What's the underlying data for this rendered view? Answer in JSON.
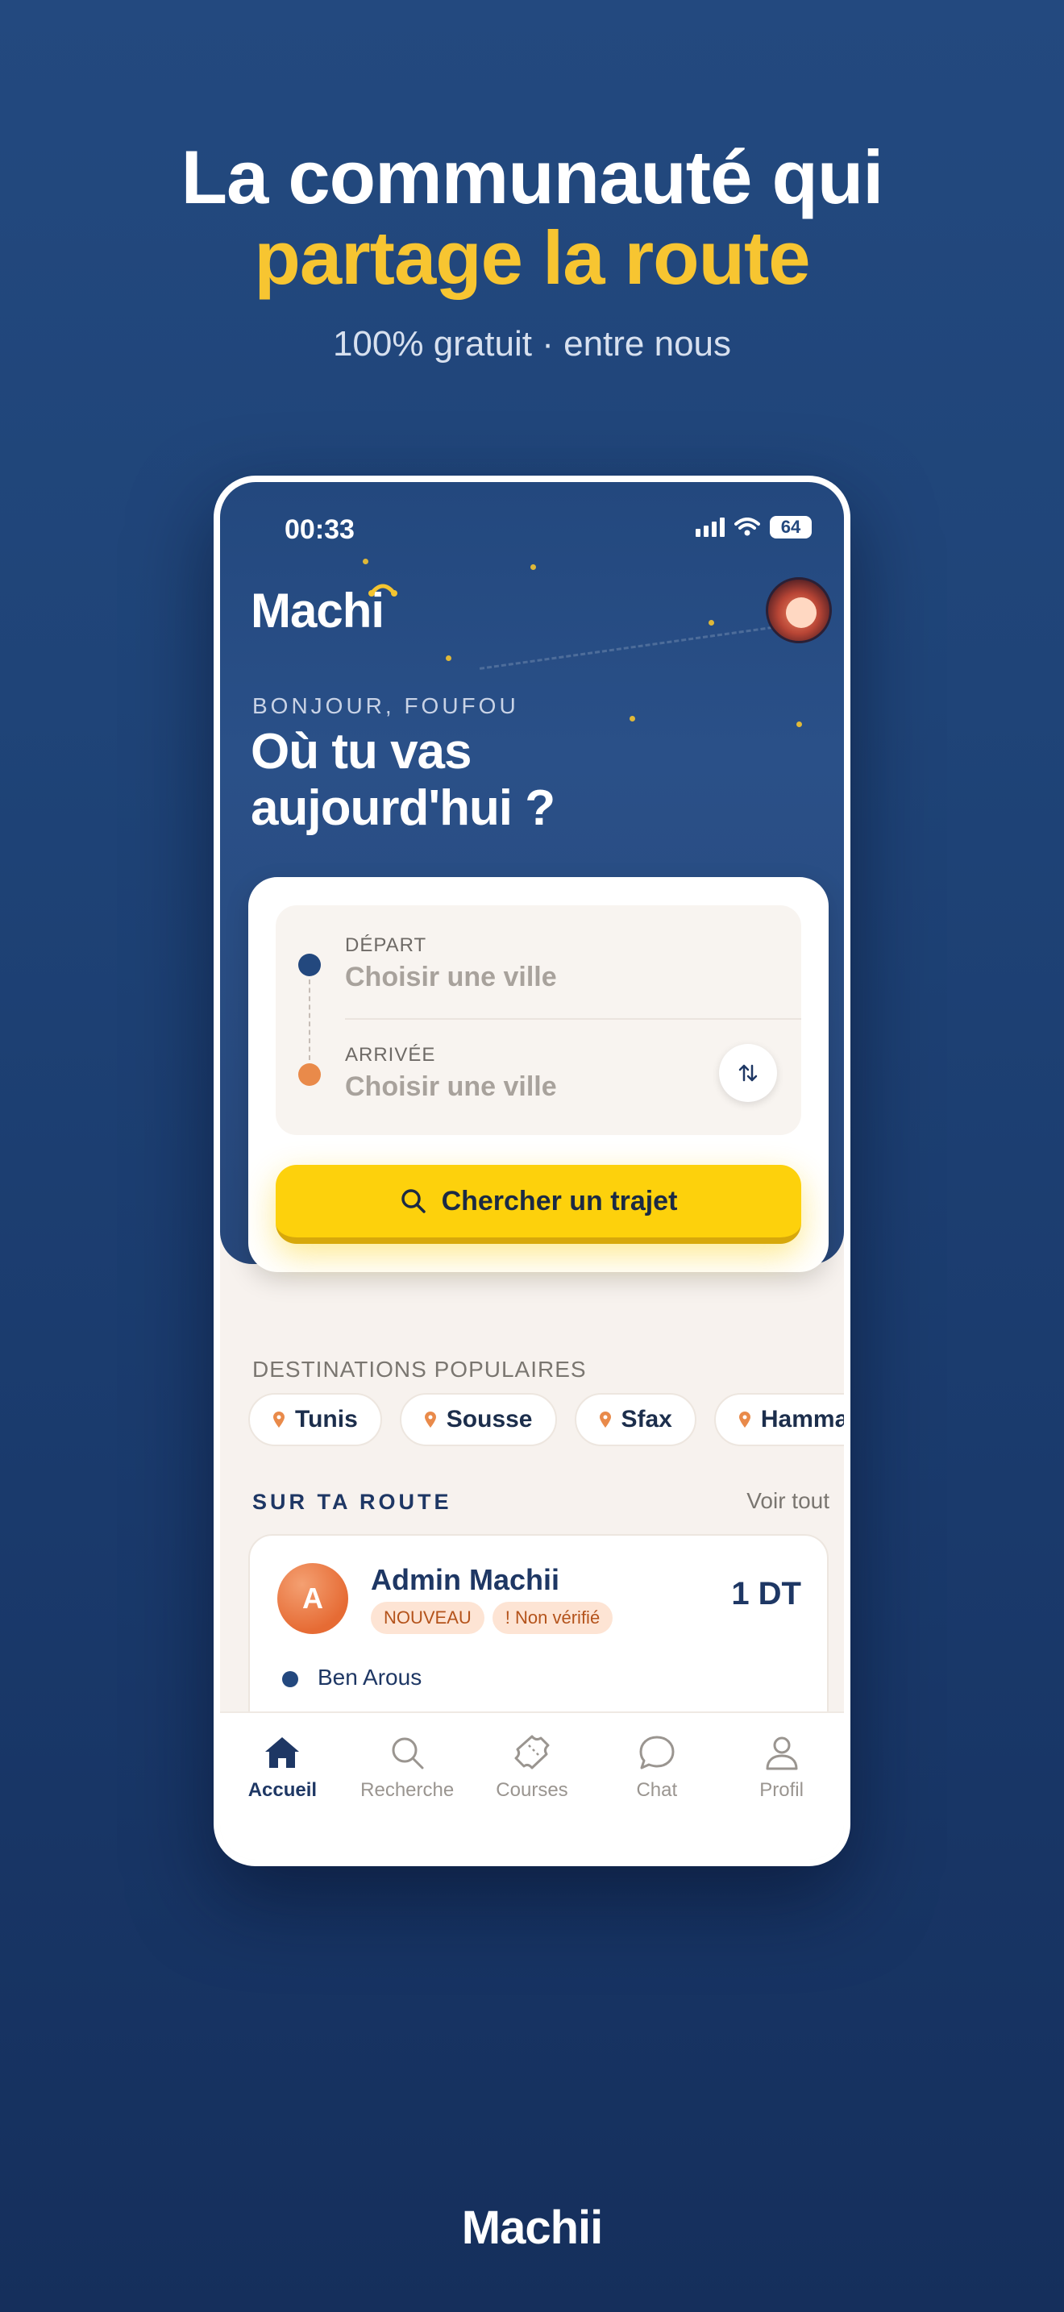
{
  "hero": {
    "line1": "La communauté qui",
    "line2": "partage la route",
    "subtitle": "100% gratuit · entre nous"
  },
  "status_bar": {
    "time": "00:33",
    "battery": "64"
  },
  "app": {
    "logo": "Machi",
    "greeting": "BONJOUR, FOUFOU",
    "question": "Où tu vas aujourd'hui ?"
  },
  "search": {
    "departure_label": "DÉPART",
    "departure_value": "Choisir une ville",
    "arrival_label": "ARRIVÉE",
    "arrival_value": "Choisir une ville",
    "button_label": "Chercher un trajet"
  },
  "destinations": {
    "title": "DESTINATIONS POPULAIRES",
    "items": [
      "Tunis",
      "Sousse",
      "Sfax",
      "Hammamet"
    ]
  },
  "route": {
    "title": "SUR TA ROUTE",
    "see_all": "Voir tout",
    "trip": {
      "initial": "A",
      "driver": "Admin Machii",
      "badge_new": "NOUVEAU",
      "badge_unverified": "! Non vérifié",
      "price": "1 DT",
      "from_city": "Ben Arous"
    }
  },
  "nav": {
    "items": [
      "Accueil",
      "Recherche",
      "Courses",
      "Chat",
      "Profil"
    ],
    "active": "Accueil"
  },
  "footer": {
    "brand": "Machii"
  },
  "colors": {
    "background": "#1f4478",
    "accent_yellow": "#fdd10c",
    "headline_yellow": "#f7c531",
    "navy": "#1e3764",
    "orange": "#e98a4a"
  },
  "icons": [
    "search-icon",
    "swap-icon",
    "pin-icon",
    "home-icon",
    "ticket-icon",
    "chat-icon",
    "user-icon",
    "wifi-icon",
    "signal-icon"
  ]
}
